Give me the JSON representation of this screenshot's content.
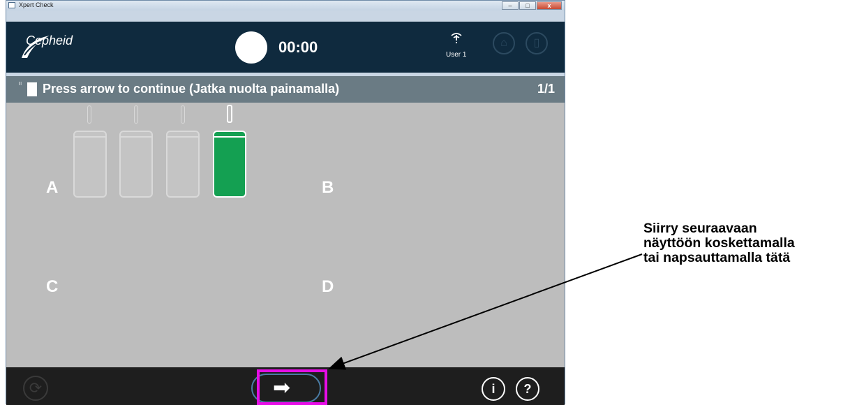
{
  "window": {
    "title": "Xpert Check",
    "controls": [
      "minimize",
      "maximize",
      "close"
    ]
  },
  "header": {
    "logo_text": "Cepheid",
    "timer": "00:00",
    "user": "User 1",
    "icons": [
      "wifi-alert-icon",
      "home-icon",
      "cartridge-icon"
    ]
  },
  "subbar": {
    "message": "Press arrow to continue  (Jatka nuolta painamalla)",
    "page": "1/1"
  },
  "content": {
    "quadrants": [
      "A",
      "B",
      "C",
      "D"
    ],
    "cartridges": [
      {
        "position": 1,
        "active": false
      },
      {
        "position": 2,
        "active": false
      },
      {
        "position": 3,
        "active": false
      },
      {
        "position": 4,
        "active": true
      }
    ],
    "colors": {
      "active_cartridge": "#14a052",
      "highlight": "#e60de6",
      "header": "#0f2a3e"
    }
  },
  "footer": {
    "reload_icon": "reload-icon",
    "next_icon": "right-arrow-icon",
    "info_label": "i",
    "help_label": "?"
  },
  "annotation": {
    "lines": [
      "Siirry seuraavaan",
      "näyttöön koskettamalla",
      "tai napsauttamalla tätä"
    ]
  }
}
